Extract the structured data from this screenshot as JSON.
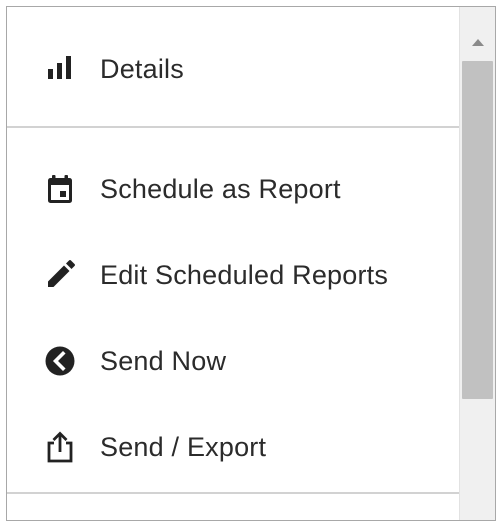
{
  "menu": {
    "items": [
      {
        "label": "Details",
        "icon": "bar-chart-icon"
      },
      {
        "label": "Schedule as Report",
        "icon": "calendar-icon"
      },
      {
        "label": "Edit Scheduled Reports",
        "icon": "pencil-icon"
      },
      {
        "label": "Send Now",
        "icon": "chevron-left-circle-icon"
      },
      {
        "label": "Send / Export",
        "icon": "share-export-icon"
      }
    ]
  },
  "colors": {
    "text": "#2b2b2b",
    "icon": "#222222",
    "divider": "#d2d2d2",
    "scroll_track": "#f0f0f0",
    "scroll_thumb": "#c1c1c1"
  }
}
